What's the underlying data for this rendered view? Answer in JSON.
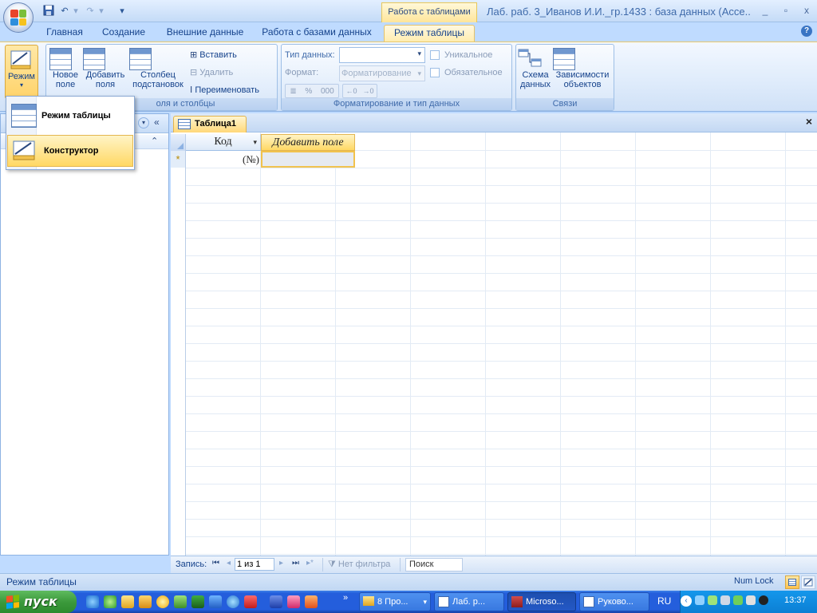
{
  "window": {
    "title": "Лаб. раб. 3_Иванов И.И._гр.1433 : база данных (Acce...",
    "context_tools": "Работа с таблицами",
    "minimize": "_",
    "restore": "▫",
    "close": "x"
  },
  "tabs": [
    "Главная",
    "Создание",
    "Внешние данные",
    "Работа с базами данных",
    "Режим таблицы"
  ],
  "ribbon": {
    "mode_label": "Режим",
    "new_field": [
      "Новое",
      "поле"
    ],
    "add_fields": [
      "Добавить",
      "поля"
    ],
    "lookup_column": [
      "Столбец",
      "подстановок"
    ],
    "insert": "Вставить",
    "delete": "Удалить",
    "rename": "Переименовать",
    "group_fields": "Поля и столбцы",
    "group_fields_visible": "оля и столбцы",
    "data_type_label": "Тип данных:",
    "format_label": "Формат:",
    "format_value": "Форматирование",
    "unique": "Уникальное",
    "required": "Обязательное",
    "percent": "%",
    "thousands": "000",
    "group_format": "Форматирование и тип данных",
    "schema": [
      "Схема",
      "данных"
    ],
    "dependencies": [
      "Зависимости",
      "объектов"
    ],
    "group_relations": "Связи"
  },
  "mode_menu": {
    "items": [
      {
        "label": "Режим таблицы",
        "icon": "datasheet-icon"
      },
      {
        "label": "Конструктор",
        "icon": "design-view-icon"
      }
    ]
  },
  "document": {
    "tab_title": "Таблица1",
    "close": "×",
    "columns": [
      "Код",
      "Добавить поле"
    ],
    "new_row_marker": "*",
    "new_row_value": "(№)"
  },
  "record_nav": {
    "label": "Запись:",
    "position": "1 из 1",
    "filter": "Нет фильтра",
    "search": "Поиск"
  },
  "status": {
    "mode": "Режим таблицы",
    "numlock": "Num Lock"
  },
  "taskbar": {
    "start": "пуск",
    "buttons": [
      "8 Про...",
      "Лаб. р...",
      "Microso...",
      "Руково..."
    ],
    "lang": "RU",
    "clock": "13:37"
  }
}
